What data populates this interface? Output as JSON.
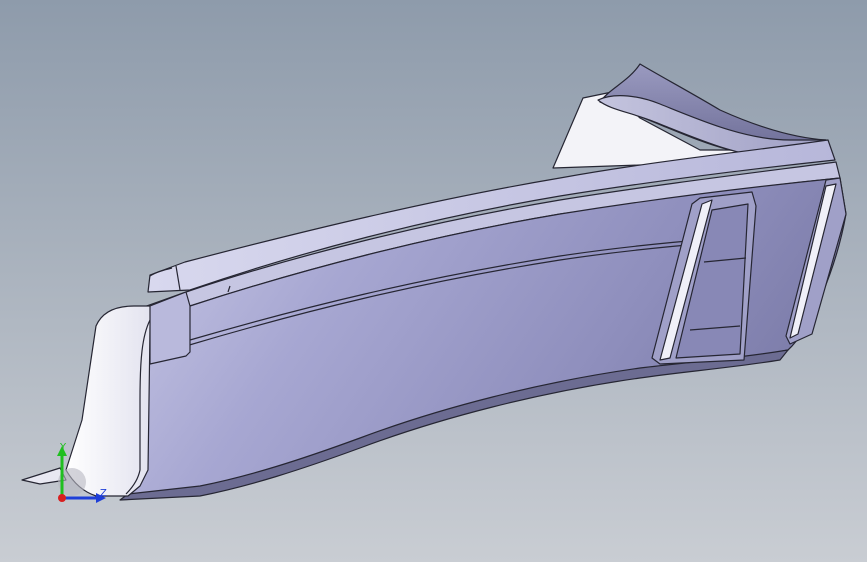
{
  "viewport": {
    "background": {
      "top_color": "#8e9bab",
      "bottom_color": "#c9cdd3"
    },
    "model": {
      "face_color": "#9b9bc6",
      "highlight_color": "#e6e6f2",
      "edge_color": "#262633"
    }
  },
  "triad": {
    "x_axis_label": "",
    "y_axis_label": "Y",
    "z_axis_label": "Z",
    "y_axis_color": "#1fbf1f",
    "z_axis_color": "#1f3fd8",
    "x_axis_color": "#d81f1f"
  }
}
